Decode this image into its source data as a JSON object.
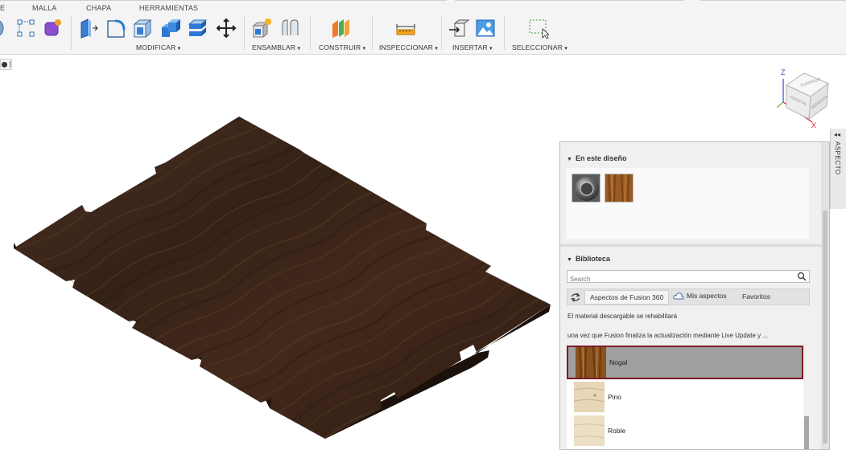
{
  "ribbon": {
    "tabs": [
      "E",
      "MALLA",
      "CHAPA",
      "HERRAMIENTAS"
    ],
    "groups": [
      "MODIFICAR",
      "ENSAMBLAR",
      "CONSTRUIR",
      "INSPECCIONAR",
      "INSERTAR",
      "SELECCIONAR"
    ]
  },
  "viewcube": {
    "axis_z": "Z",
    "axis_x": "X",
    "faces": [
      "SUPERIOR",
      "FRONTAL",
      "DERECHA"
    ]
  },
  "side_tab": {
    "arrows": "◂◂",
    "label": "ASPECTO"
  },
  "panel": {
    "in_design_title": "En este diseño",
    "library_title": "Biblioteca",
    "search_placeholder": "Search",
    "tabs": [
      "Aspectos de Fusion 360",
      "Mis aspectos",
      "Favoritos"
    ],
    "note_line1": "El material descargable se rehabilitará",
    "note_line2": "una vez que Fusion finaliza la actualización mediante Live Update y ...",
    "materials": [
      {
        "name": "Nogal",
        "selected": true
      },
      {
        "name": "Pino",
        "selected": false
      },
      {
        "name": "Roble",
        "selected": false
      }
    ]
  },
  "colors": {
    "walnut": "#3a2519",
    "selection_border": "#7d1b2a",
    "axis_z": "#3b46c8",
    "axis_x": "#d42323"
  },
  "icons": {
    "search": "search-icon",
    "refresh": "refresh-icon",
    "cloud": "cloud-icon",
    "move": "move-icon",
    "select": "select-window-icon"
  }
}
